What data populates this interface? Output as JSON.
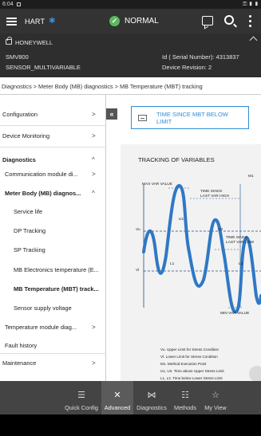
{
  "status_bar": {
    "time": "6:04",
    "right_icons": "⚿ ▮ ▮"
  },
  "topbar": {
    "protocol": "HART",
    "bluetooth_icon": "bluetooth-icon",
    "status_icon": "check-circle-icon",
    "status_text": "NORMAL",
    "status_color": "#5cb85c",
    "actions": [
      "chat-icon",
      "search-icon",
      "kebab-menu-icon"
    ]
  },
  "device": {
    "manufacturer": "HONEYWELL",
    "model": "SMV800",
    "tag": "SENSOR_MULTIVARIABLE",
    "serial": "Id ( Serial Number): 4313837",
    "revision": "Device Revision: 2"
  },
  "breadcrumb": "Diagnostics > Meter Body (MB) diagnostics > MB Temperature (MBT) tracking",
  "sidebar": {
    "items": [
      {
        "label": "Configuration",
        "chevron": ">"
      },
      {
        "label": "Device Monitoring",
        "chevron": ">"
      },
      {
        "label": "Diagnostics",
        "chevron": "^"
      },
      {
        "label": "Communication module di...",
        "chevron": ">"
      },
      {
        "label": "Meter Body (MB) diagnos...",
        "chevron": "^"
      },
      {
        "label": "Service life"
      },
      {
        "label": "DP Tracking"
      },
      {
        "label": "SP Tracking"
      },
      {
        "label": "MB Electronics temperature (E..."
      },
      {
        "label": "MB Temperature (MBT) track..."
      },
      {
        "label": "Sensor supply voltage"
      },
      {
        "label": "Temperature module diag...",
        "chevron": ">"
      },
      {
        "label": "Fault history"
      },
      {
        "label": "Maintenance",
        "chevron": ">"
      }
    ]
  },
  "main": {
    "back_label": "«",
    "method_button_label": "TIME SINCE MBT BELOW LIMIT",
    "method_button_color": "#2f8ed8",
    "figure": {
      "title": "TRACKING OF VARIABLES",
      "labels": {
        "max_var": "MAX VAR VALUE",
        "m1": "M1",
        "time_last_high": "TIME SINCE LAST VAR HIGH",
        "u1": "U1",
        "u2": "U2",
        "time_last_low": "TIME SINCE LAST VAR LOW",
        "vu": "Vu",
        "vl": "Vl",
        "l1": "L1",
        "l2": "L2",
        "min_var": "MIN VAR VALUE"
      },
      "legend": [
        "Vu. Upper Limit for Stress Condition",
        "Vl. Lower Limit for Stress Condition",
        "M1. Method Execution Point",
        "U1, U2. Time above Upper Stress Limit",
        "L1, L2. Time below Lower Stress Limit"
      ]
    }
  },
  "bottom_nav": {
    "items": [
      {
        "label": "Quick Config",
        "icon": "sliders-icon"
      },
      {
        "label": "Advanced",
        "icon": "tools-icon"
      },
      {
        "label": "Diagnostics",
        "icon": "diagnostics-icon"
      },
      {
        "label": "Methods",
        "icon": "methods-icon"
      },
      {
        "label": "My View",
        "icon": "star-icon"
      }
    ],
    "active": "Advanced"
  }
}
